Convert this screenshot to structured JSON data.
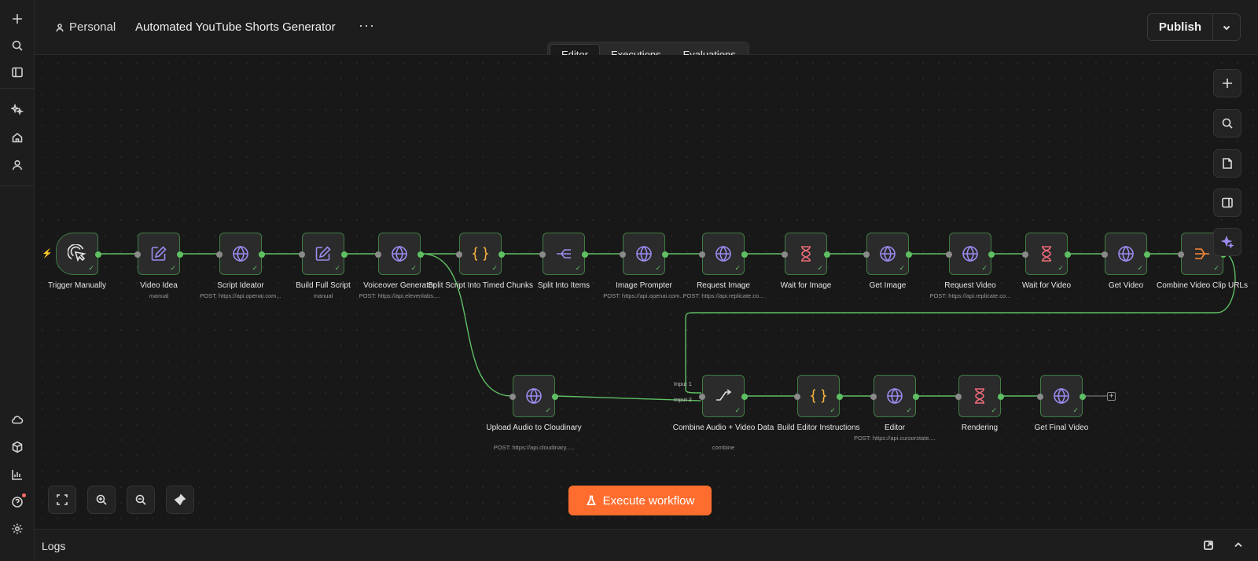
{
  "header": {
    "project": "Personal",
    "title": "Automated YouTube Shorts Generator",
    "more": "···",
    "publish_label": "Publish"
  },
  "tabs": [
    "Editor",
    "Executions",
    "Evaluations"
  ],
  "execute_label": "Execute workflow",
  "logs_label": "Logs",
  "nodes": [
    {
      "label": "Trigger Manually",
      "sub": "",
      "icon": "cursor-click-icon"
    },
    {
      "label": "Video Idea",
      "sub": "manual",
      "icon": "edit-icon"
    },
    {
      "label": "Script Ideator",
      "sub": "POST: https://api.openai.com...",
      "icon": "globe-icon"
    },
    {
      "label": "Build Full Script",
      "sub": "manual",
      "icon": "edit-icon"
    },
    {
      "label": "Voiceover Generator",
      "sub": "POST: https://api.elevenlabs....",
      "icon": "globe-icon"
    },
    {
      "label": "Split Script Into Timed Chunks",
      "sub": "",
      "icon": "code-braces-icon"
    },
    {
      "label": "Split Into Items",
      "sub": "",
      "icon": "split-icon"
    },
    {
      "label": "Image Prompter",
      "sub": "POST: https://api.openai.com...",
      "icon": "globe-icon"
    },
    {
      "label": "Request Image",
      "sub": "POST: https://api.replicate.co...",
      "icon": "globe-icon"
    },
    {
      "label": "Wait for Image",
      "sub": "",
      "icon": "hourglass-icon"
    },
    {
      "label": "Get Image",
      "sub": "",
      "icon": "globe-icon"
    },
    {
      "label": "Request Video",
      "sub": "POST: https://api.replicate.co...",
      "icon": "globe-icon"
    },
    {
      "label": "Wait for Video",
      "sub": "",
      "icon": "hourglass-icon"
    },
    {
      "label": "Get Video",
      "sub": "",
      "icon": "globe-icon"
    },
    {
      "label": "Combine Video Clip URLs",
      "sub": "",
      "icon": "aggregate-icon"
    },
    {
      "label": "Upload Audio to Cloudinary",
      "sub": "POST: https://api.cloudinary.....",
      "icon": "globe-icon"
    },
    {
      "label": "Combine Audio + Video Data",
      "sub": "combine",
      "icon": "merge-icon"
    },
    {
      "label": "Build Editor Instructions",
      "sub": "",
      "icon": "code-braces-icon"
    },
    {
      "label": "Editor",
      "sub": "POST: https://api.cursorstate....",
      "icon": "globe-icon"
    },
    {
      "label": "Rendering",
      "sub": "",
      "icon": "hourglass-icon"
    },
    {
      "label": "Get Final Video",
      "sub": "",
      "icon": "globe-icon"
    }
  ],
  "merge_inputs": [
    "Input 1",
    "Input 2"
  ],
  "colors": {
    "wire": "#5fbf63",
    "node_border": "#3f7d43",
    "globe": "#9a8cf0",
    "braces": "#f5b13d",
    "hourglass": "#f06b7a",
    "aggregate": "#ff8a3d",
    "accent": "#ff6d2e"
  }
}
